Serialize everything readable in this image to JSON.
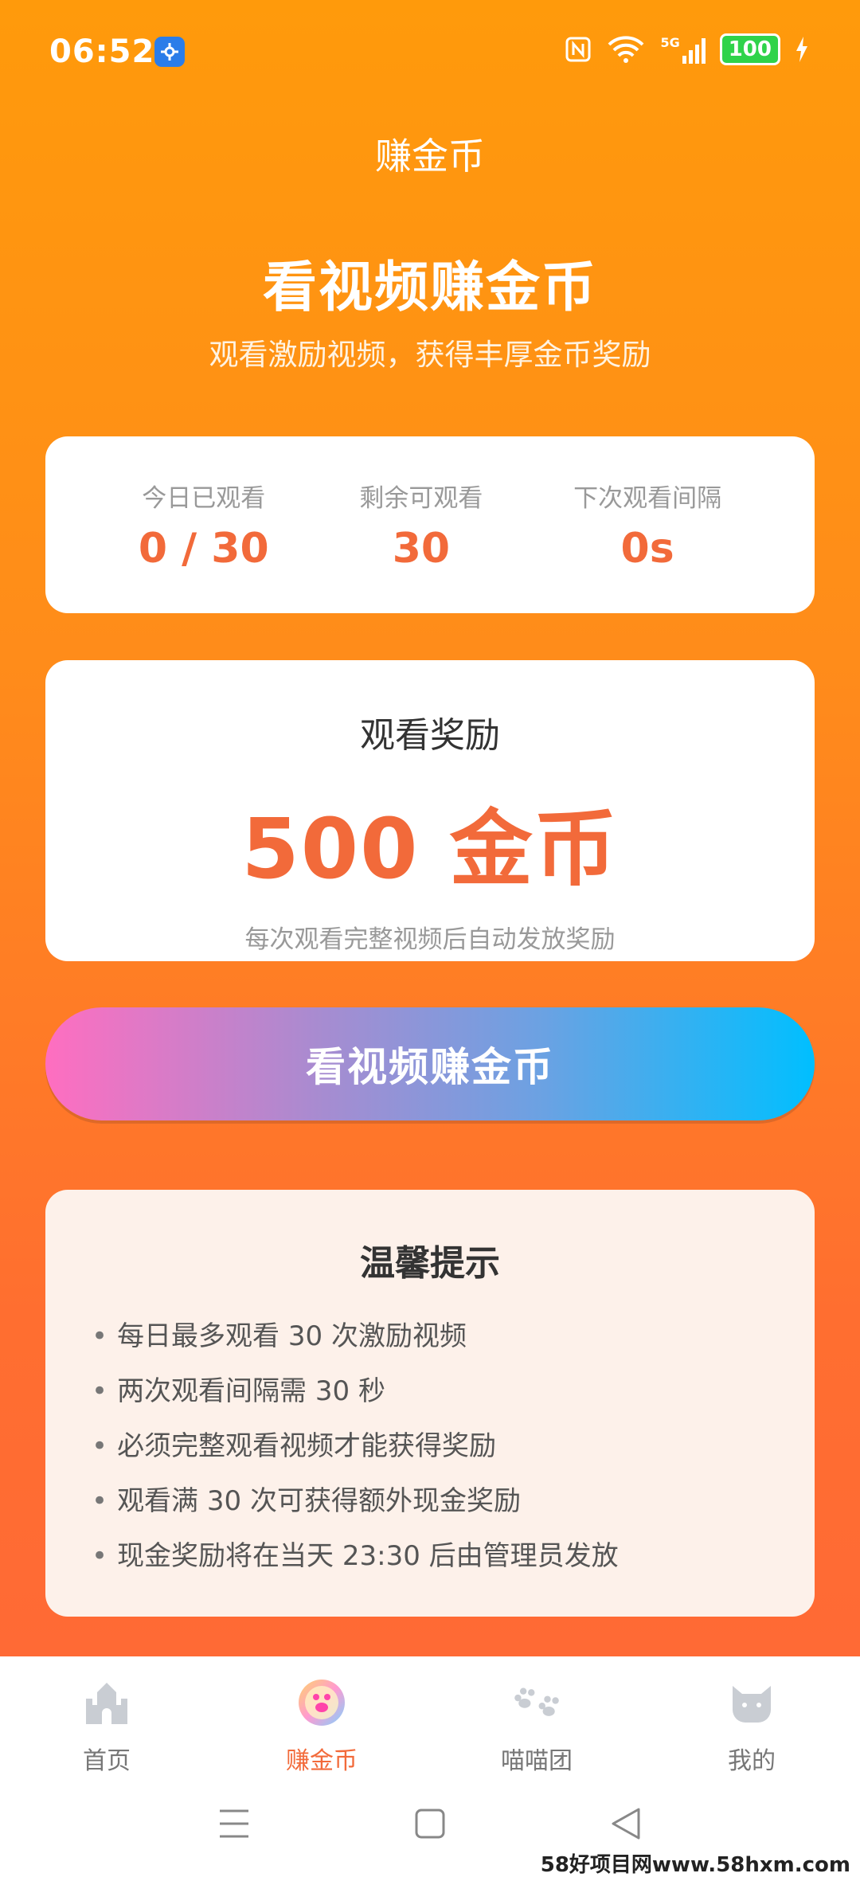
{
  "status_bar": {
    "time": "06:52",
    "battery": "100",
    "signal_label": "5G"
  },
  "header": {
    "title": "赚金币"
  },
  "hero": {
    "title": "看视频赚金币",
    "subtitle": "观看激励视频，获得丰厚金币奖励"
  },
  "stats": [
    {
      "label": "今日已观看",
      "value": "0 / 30"
    },
    {
      "label": "剩余可观看",
      "value": "30"
    },
    {
      "label": "下次观看间隔",
      "value": "0s"
    }
  ],
  "reward": {
    "label": "观看奖励",
    "amount": "500 金币",
    "description": "每次观看完整视频后自动发放奖励"
  },
  "cta": {
    "label": "看视频赚金币"
  },
  "tips": {
    "title": "温馨提示",
    "items": [
      "每日最多观看 30 次激励视频",
      "两次观看间隔需 30 秒",
      "必须完整观看视频才能获得奖励",
      "观看满 30 次可获得额外现金奖励",
      "现金奖励将在当天 23:30 后由管理员发放"
    ]
  },
  "tabbar": {
    "items": [
      {
        "label": "首页",
        "icon": "castle-icon"
      },
      {
        "label": "赚金币",
        "icon": "coin-icon",
        "active": true
      },
      {
        "label": "喵喵团",
        "icon": "paw-icon"
      },
      {
        "label": "我的",
        "icon": "cat-face-icon"
      }
    ]
  },
  "watermark": "58好项目网www.58hxm.com",
  "colors": {
    "accent": "#F26A3A",
    "bg_top": "#FF9A0B",
    "bg_bottom": "#FF6A35"
  }
}
